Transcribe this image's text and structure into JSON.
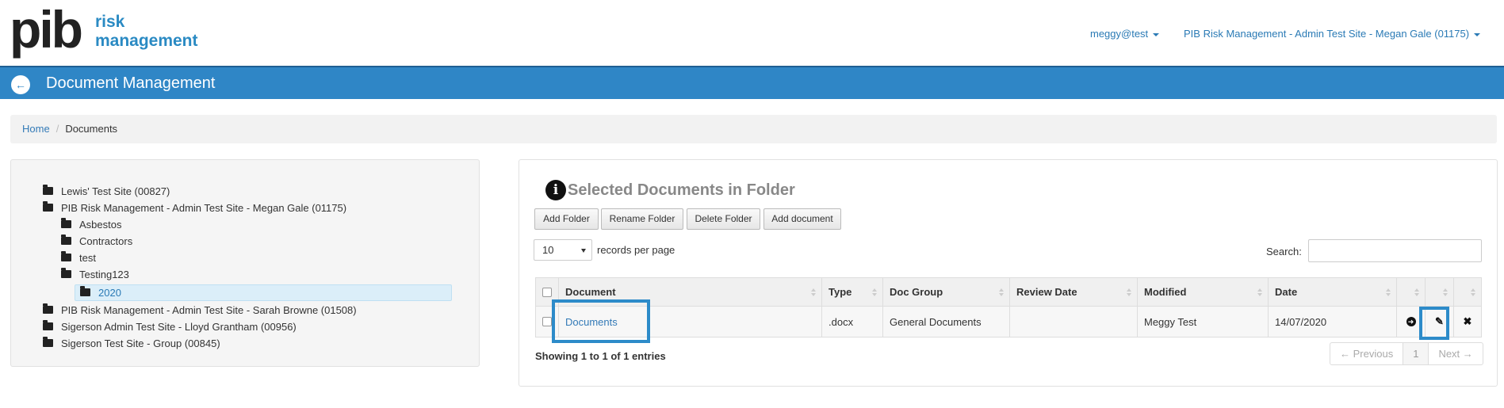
{
  "header": {
    "logo_main": "pib",
    "logo_line1": "risk",
    "logo_line2": "management",
    "user": "meggy@test",
    "site": "PIB Risk Management - Admin Test Site - Megan Gale (01175)"
  },
  "titlebar": {
    "title": "Document Management",
    "back_icon": "arrow-left-circle-icon"
  },
  "breadcrumb": {
    "home": "Home",
    "current": "Documents"
  },
  "tree": [
    {
      "label": "Lewis' Test Site (00827)",
      "icon": "folder-icon"
    },
    {
      "label": "PIB Risk Management - Admin Test Site - Megan Gale (01175)",
      "icon": "folder-open-icon"
    },
    {
      "label": "Asbestos",
      "icon": "folder-icon"
    },
    {
      "label": "Contractors",
      "icon": "folder-icon"
    },
    {
      "label": "test",
      "icon": "folder-icon"
    },
    {
      "label": "Testing123",
      "icon": "folder-open-icon"
    },
    {
      "label": "2020",
      "icon": "folder-icon",
      "selected": true
    },
    {
      "label": "PIB Risk Management - Admin Test Site - Sarah Browne (01508)",
      "icon": "folder-icon"
    },
    {
      "label": "Sigerson Admin Test Site - Lloyd Grantham (00956)",
      "icon": "folder-icon"
    },
    {
      "label": "Sigerson Test Site - Group (00845)",
      "icon": "folder-icon"
    }
  ],
  "panel": {
    "title": "Selected Documents in Folder",
    "buttons": {
      "add_folder": "Add Folder",
      "rename_folder": "Rename Folder",
      "delete_folder": "Delete Folder",
      "add_document": "Add document"
    },
    "records_per_page": "10",
    "records_label": "records per page",
    "search_label": "Search:",
    "search_value": ""
  },
  "table": {
    "columns": [
      "Document",
      "Type",
      "Doc Group",
      "Review Date",
      "Modified",
      "Date"
    ],
    "rows": [
      {
        "document": "Documents",
        "type": ".docx",
        "doc_group": "General Documents",
        "review_date": "",
        "modified": "Meggy Test",
        "date": "14/07/2020"
      }
    ],
    "showing": "Showing 1 to 1 of 1 entries",
    "pager": {
      "previous": "← Previous",
      "page": "1",
      "next": "Next →"
    }
  }
}
